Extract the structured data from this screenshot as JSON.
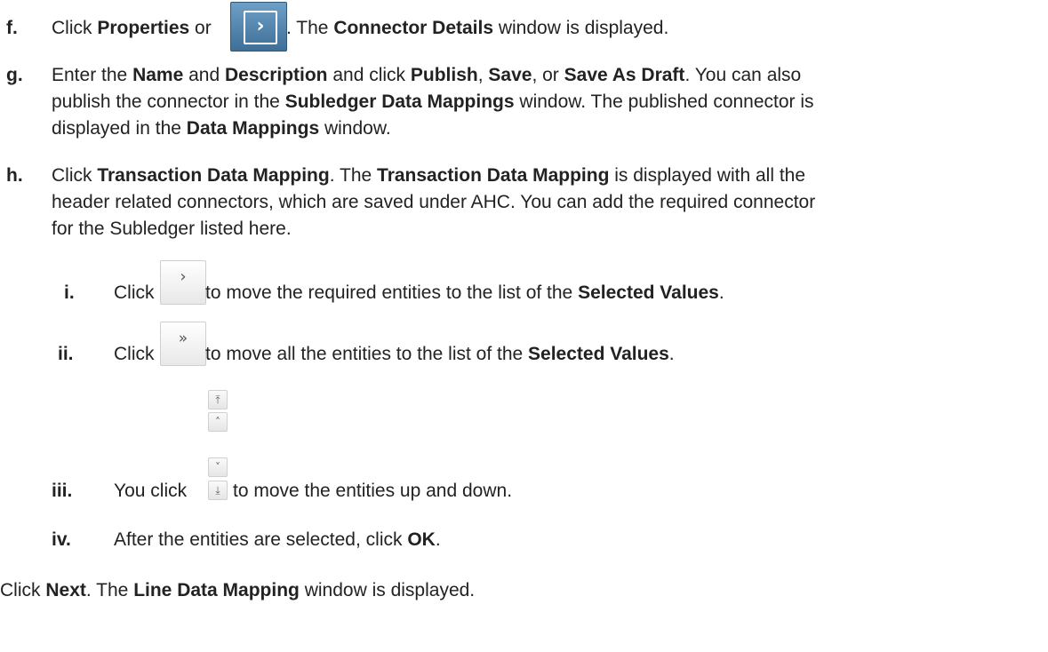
{
  "steps": {
    "f": {
      "label": "f.",
      "t1": "Click ",
      "b1": "Properties",
      "t2": " or ",
      "t3": ". The ",
      "b2": "Connector Details",
      "t4": " window is displayed."
    },
    "g": {
      "label": "g.",
      "l1": {
        "t1": "Enter the ",
        "b1": "Name",
        "t2": " and ",
        "b2": "Description",
        "t3": " and click ",
        "b3": "Publish",
        "t4": ", ",
        "b4": "Save",
        "t5": ", or ",
        "b5": "Save As Draft",
        "t6": ". You can also"
      },
      "l2": {
        "t1": "publish the connector in the ",
        "b1": "Subledger Data Mappings",
        "t2": " window. The published connector is"
      },
      "l3": {
        "t1": "displayed in the ",
        "b1": "Data Mappings",
        "t2": " window."
      }
    },
    "h": {
      "label": "h.",
      "l1": {
        "t1": "Click ",
        "b1": "Transaction Data Mapping",
        "t2": ". The ",
        "b2": "Transaction Data Mapping",
        "t3": " is displayed with all the"
      },
      "l2": "header related connectors, which are saved under AHC. You can add the required connector",
      "l3": "for the Subledger listed here."
    },
    "i": {
      "label": "i.",
      "t1": "Click",
      "t2": " to move the required entities to the list of the ",
      "b1": "Selected Values",
      "t3": "."
    },
    "ii": {
      "label": "ii.",
      "t1": "Click",
      "t2": " to move all the entities to the list of the ",
      "b1": "Selected Values",
      "t3": "."
    },
    "iii": {
      "label": "iii.",
      "t1": "You click",
      "t2": " to move the entities up and down."
    },
    "iv": {
      "label": "iv.",
      "t1": "After the entities are selected, click ",
      "b1": "OK",
      "t2": "."
    },
    "final": {
      "t1": "Click ",
      "b1": "Next",
      "t2": ". The ",
      "b2": "Line Data Mapping",
      "t3": " window is displayed."
    }
  },
  "icons": {
    "properties": "chevron-right-icon",
    "move": "chevron-right-icon",
    "move_all": "double-chevron-right-icon",
    "reorder": [
      "move-to-top-icon",
      "move-up-icon",
      "move-down-icon",
      "move-to-bottom-icon"
    ]
  },
  "colors": {
    "accent": "#4a7aa3",
    "text": "#222222"
  }
}
